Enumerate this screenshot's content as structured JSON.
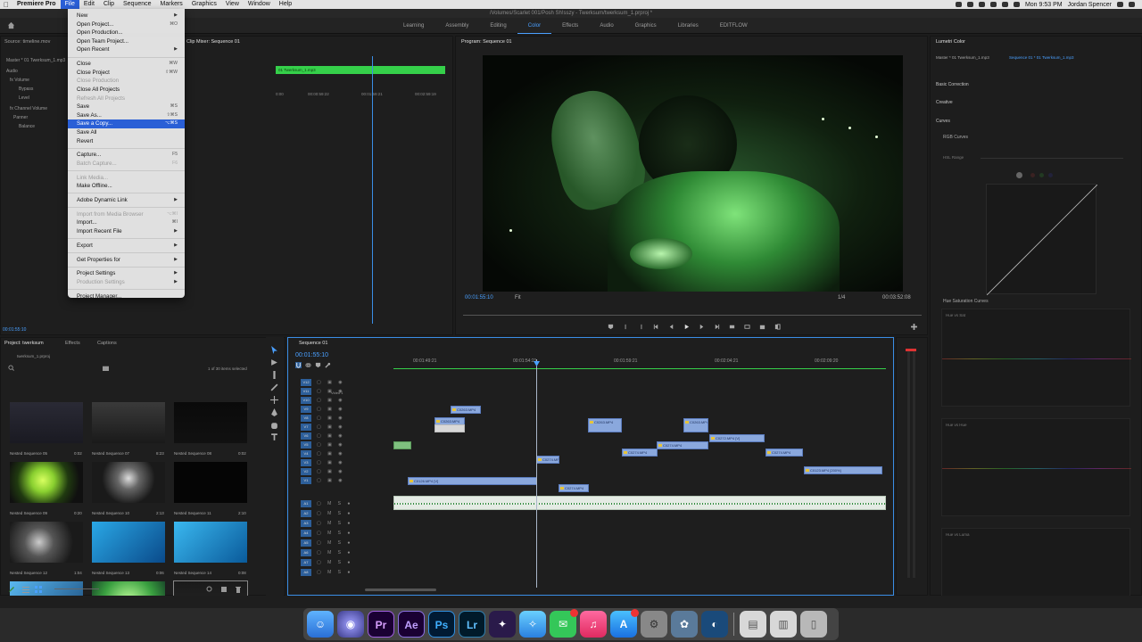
{
  "menubar": {
    "app_name": "Premiere Pro",
    "items": [
      "File",
      "Edit",
      "Clip",
      "Sequence",
      "Markers",
      "Graphics",
      "View",
      "Window",
      "Help"
    ],
    "clock": "Mon 9:53 PM",
    "user": "Jordan Spencer"
  },
  "title": "/Volumes/Scarlet 001/Posh Sh!sszy - Twerksum/twerksum_1.prproj *",
  "workspaces": [
    "Learning",
    "Assembly",
    "Editing",
    "Color",
    "Effects",
    "Audio",
    "Graphics",
    "Libraries",
    "EDITFLOW"
  ],
  "active_workspace": "Color",
  "file_menu": [
    {
      "label": "New",
      "shortcut": "",
      "disabled": false,
      "submenu": true
    },
    {
      "label": "Open Project...",
      "shortcut": "⌘O",
      "disabled": false
    },
    {
      "label": "Open Production...",
      "shortcut": "",
      "disabled": false
    },
    {
      "label": "Open Team Project...",
      "shortcut": "",
      "disabled": false
    },
    {
      "label": "Open Recent",
      "shortcut": "",
      "disabled": false,
      "submenu": true
    },
    {
      "sep": true
    },
    {
      "label": "Close",
      "shortcut": "⌘W",
      "disabled": false
    },
    {
      "label": "Close Project",
      "shortcut": "⇧⌘W",
      "disabled": false
    },
    {
      "label": "Close Production",
      "shortcut": "",
      "disabled": true
    },
    {
      "label": "Close All Projects",
      "shortcut": "",
      "disabled": false
    },
    {
      "label": "Refresh All Projects",
      "shortcut": "",
      "disabled": true
    },
    {
      "label": "Save",
      "shortcut": "⌘S",
      "disabled": false
    },
    {
      "label": "Save As...",
      "shortcut": "⇧⌘S",
      "disabled": false
    },
    {
      "label": "Save a Copy...",
      "shortcut": "⌥⌘S",
      "disabled": false,
      "highlight": true
    },
    {
      "label": "Save All",
      "shortcut": "",
      "disabled": false
    },
    {
      "label": "Revert",
      "shortcut": "",
      "disabled": false
    },
    {
      "sep": true
    },
    {
      "label": "Capture...",
      "shortcut": "F5",
      "disabled": false
    },
    {
      "label": "Batch Capture...",
      "shortcut": "F6",
      "disabled": true
    },
    {
      "sep": true
    },
    {
      "label": "Link Media...",
      "shortcut": "",
      "disabled": true
    },
    {
      "label": "Make Offline...",
      "shortcut": "",
      "disabled": false
    },
    {
      "sep": true
    },
    {
      "label": "Adobe Dynamic Link",
      "shortcut": "",
      "disabled": false,
      "submenu": true
    },
    {
      "sep": true
    },
    {
      "label": "Import from Media Browser",
      "shortcut": "⌥⌘I",
      "disabled": true
    },
    {
      "label": "Import...",
      "shortcut": "⌘I",
      "disabled": false
    },
    {
      "label": "Import Recent File",
      "shortcut": "",
      "disabled": false,
      "submenu": true
    },
    {
      "sep": true
    },
    {
      "label": "Export",
      "shortcut": "",
      "disabled": false,
      "submenu": true
    },
    {
      "sep": true
    },
    {
      "label": "Get Properties for",
      "shortcut": "",
      "disabled": false,
      "submenu": true
    },
    {
      "sep": true
    },
    {
      "label": "Project Settings",
      "shortcut": "",
      "disabled": false,
      "submenu": true
    },
    {
      "label": "Production Settings",
      "shortcut": "",
      "disabled": true,
      "submenu": true
    },
    {
      "sep": true
    },
    {
      "label": "Project Manager...",
      "shortcut": "",
      "disabled": false
    }
  ],
  "effect_controls": {
    "source_tab": "Source: timeline.mov",
    "clip_tab": "Clip Mixer: Sequence 01",
    "master_label": "Master * 01 Twerksum_1.mp3",
    "section_audio": "Audio",
    "rows": [
      "fx Volume",
      "Bypass",
      "Level",
      "fx Channel Volume",
      "Panner",
      "Balance"
    ],
    "clip_name": "01 Twerksum_1.mp3",
    "ruler": [
      "0:00",
      "00:00:59:22",
      "00:01:59:21",
      "00:02:59:19"
    ],
    "bottom_time": "00:01:55:10"
  },
  "program": {
    "tab": "Program: Sequence 01",
    "timecode": "00:01:55:10",
    "fit": "Fit",
    "quality": "1/4",
    "duration": "00:03:52:08"
  },
  "lumetri": {
    "tab": "Lumetri Color",
    "master": "Master * 01 Twerksum_1.mp3",
    "sequence": "Sequence 01 * 01 Twerksum_1.mp3",
    "sections": [
      "Basic Correction",
      "Creative",
      "Curves",
      "RGB Curves"
    ],
    "hsl_range": "HSL Range",
    "hs_curves": "Hue Saturation Curves",
    "hs_items": [
      "Hue vs Sat",
      "Hue vs Hue",
      "Hue vs Luma"
    ]
  },
  "project": {
    "tabs": [
      "Project: twerksum",
      "Effects",
      "Captions"
    ],
    "file": "twerksum_1.prproj",
    "selection": "1 of 30 items selected",
    "thumbs": [
      {
        "label": "Nested Sequence 05",
        "dur": "0:02"
      },
      {
        "label": "Nested Sequence 07",
        "dur": "8:23"
      },
      {
        "label": "Nested Sequence 08",
        "dur": "0:02"
      },
      {
        "label": "Nested Sequence 09",
        "dur": "0:20"
      },
      {
        "label": "Nested Sequence 10",
        "dur": "2:13"
      },
      {
        "label": "Nested Sequence 11",
        "dur": "2:10"
      },
      {
        "label": "Nested Sequence 12",
        "dur": "1:04"
      },
      {
        "label": "Nested Sequence 13",
        "dur": "0:06"
      },
      {
        "label": "Nested Sequence 14",
        "dur": "0:08"
      },
      {
        "label": "Nested Sequence 15",
        "dur": "1:37"
      },
      {
        "label": "pills.mp4",
        "dur": "2:23"
      },
      {
        "label": "Nested Sequence 16",
        "dur": "1:21"
      }
    ]
  },
  "timeline": {
    "tab": "Sequence 01",
    "timecode": "00:01:55:10",
    "ruler": [
      "00:01:49:21",
      "00:01:54:21",
      "00:01:59:21",
      "00:02:04:21",
      "00:02:09:20"
    ],
    "v1_label": "Video 1",
    "track_labels": [
      "V12",
      "V11",
      "V10",
      "V9",
      "V8",
      "V7",
      "V6",
      "V5",
      "V4",
      "V3",
      "V2",
      "V1",
      "A1",
      "A2",
      "A3",
      "A4",
      "A5",
      "A6",
      "A7",
      "A8"
    ],
    "clips": [
      "C0263.MP4",
      "C0272.MP4 [V]",
      "C0274.MP4",
      "C0123.MP4 [200%]",
      "C0126.MP4 [V]",
      "C0252.MP4 [200%]"
    ]
  }
}
